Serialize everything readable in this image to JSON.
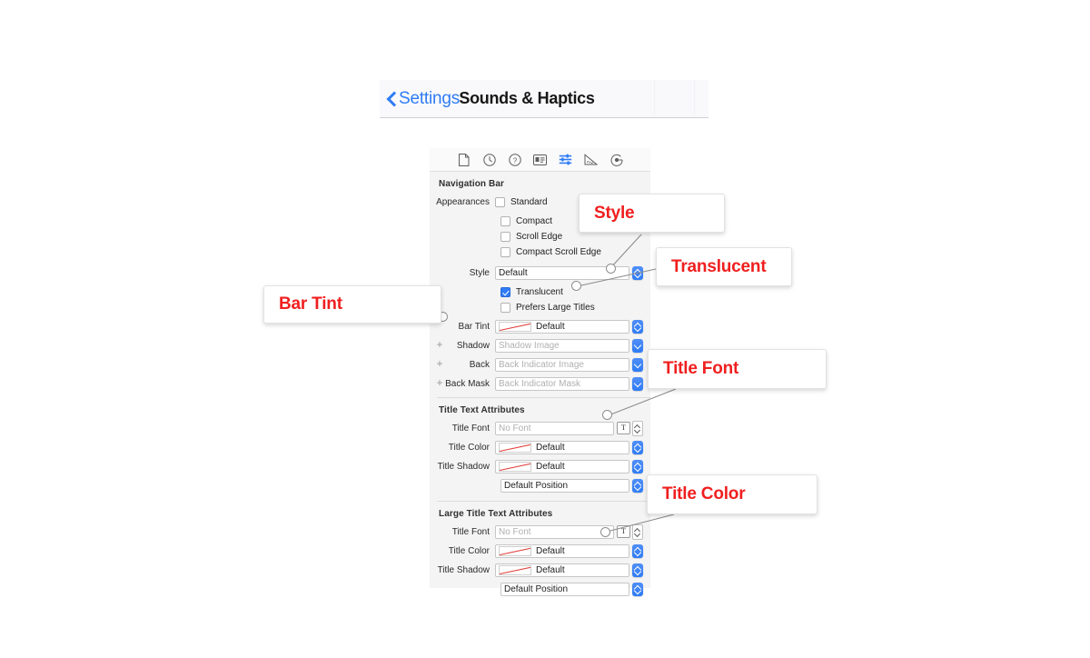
{
  "navbar": {
    "back_label": "Settings",
    "title": "Sounds & Haptics",
    "back_icon": "chevron-left-icon",
    "accent_color": "#2f7cf6"
  },
  "inspector": {
    "toolbar_icons": [
      {
        "name": "file-inspector-icon",
        "glyph": "file",
        "selected": false
      },
      {
        "name": "history-inspector-icon",
        "glyph": "clock",
        "selected": false
      },
      {
        "name": "quick-help-inspector-icon",
        "glyph": "question",
        "selected": false
      },
      {
        "name": "identity-inspector-icon",
        "glyph": "id-card",
        "selected": false
      },
      {
        "name": "attributes-inspector-icon",
        "glyph": "sliders",
        "selected": true
      },
      {
        "name": "size-inspector-icon",
        "glyph": "ruler",
        "selected": false
      },
      {
        "name": "connections-inspector-icon",
        "glyph": "connections",
        "selected": false
      }
    ],
    "sections": [
      {
        "heading": "Navigation Bar",
        "appearances_label": "Appearances",
        "appearances": [
          {
            "label": "Standard",
            "checked": false
          },
          {
            "label": "Compact",
            "checked": false
          },
          {
            "label": "Scroll Edge",
            "checked": false
          },
          {
            "label": "Compact Scroll Edge",
            "checked": false
          }
        ],
        "style_label": "Style",
        "style_value": "Default",
        "translucent_label": "Translucent",
        "translucent_checked": true,
        "prefers_large_titles_label": "Prefers Large Titles",
        "prefers_large_titles_checked": false,
        "bar_tint_label": "Bar Tint",
        "bar_tint_value": "Default",
        "shadow_label": "Shadow",
        "shadow_placeholder": "Shadow Image",
        "back_label": "Back",
        "back_placeholder": "Back Indicator Image",
        "back_mask_label": "Back Mask",
        "back_mask_placeholder": "Back Indicator Mask"
      },
      {
        "heading": "Title Text Attributes",
        "title_font_label": "Title Font",
        "title_font_placeholder": "No Font",
        "title_color_label": "Title Color",
        "title_color_value": "Default",
        "title_shadow_label": "Title Shadow",
        "title_shadow_value": "Default",
        "position_value": "Default Position"
      },
      {
        "heading": "Large Title Text Attributes",
        "title_font_label": "Title Font",
        "title_font_placeholder": "No Font",
        "title_color_label": "Title Color",
        "title_color_value": "Default",
        "title_shadow_label": "Title Shadow",
        "title_shadow_value": "Default",
        "position_value": "Default Position"
      }
    ]
  },
  "callouts": [
    {
      "name": "callout-style",
      "label": "Style"
    },
    {
      "name": "callout-translucent",
      "label": "Translucent"
    },
    {
      "name": "callout-bar-tint",
      "label": "Bar Tint"
    },
    {
      "name": "callout-title-font",
      "label": "Title Font"
    },
    {
      "name": "callout-title-color",
      "label": "Title Color"
    }
  ],
  "colors": {
    "callout_text": "#f01f1f",
    "accent": "#2f7cf6",
    "panel_bg": "#f4f4f4"
  }
}
